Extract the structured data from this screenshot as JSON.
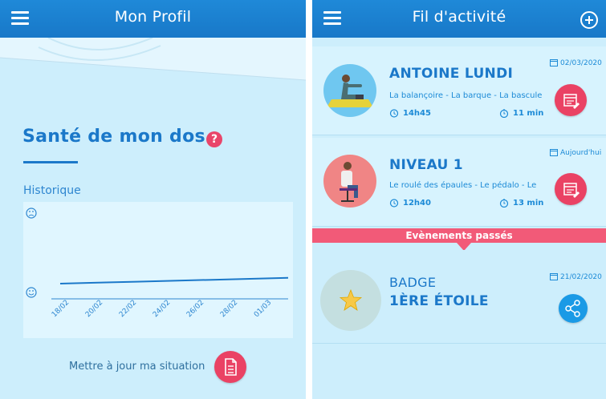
{
  "left_screen": {
    "header_title": "Mon Profil",
    "section_title": "Santé de mon dos",
    "help_symbol": "?",
    "history_label": "Historique",
    "chart_data": {
      "type": "line",
      "x_ticks": [
        "18/02",
        "20/02",
        "22/02",
        "24/02",
        "26/02",
        "28/02",
        "01/03"
      ],
      "y_axis_icons": [
        "sad-face-icon",
        "smile-face-icon"
      ],
      "series": [
        {
          "values": [
            0.78,
            0.8,
            0.82,
            0.84,
            0.86,
            0.88,
            0.9
          ]
        }
      ]
    },
    "update_label": "Mettre à jour ma situation",
    "update_icon": "document-icon"
  },
  "right_screen": {
    "header_title": "Fil d'activité",
    "activities": [
      {
        "name": "ANTOINE LUNDI",
        "description": "La balançoire - La barque - La bascule",
        "time": "14h45",
        "duration": "11 min",
        "date": "02/03/2020"
      },
      {
        "name": "NIVEAU 1",
        "description": "Le roulé des épaules - Le pédalo - Le",
        "time": "12h40",
        "duration": "13 min",
        "date": "Aujourd'hui"
      }
    ],
    "past_events_label": "Evènements passés",
    "past_event": {
      "label": "BADGE",
      "name": "1ÈRE ÉTOILE",
      "date": "21/02/2020"
    }
  },
  "colors": {
    "header_blue": "#1878c8",
    "background": "#cdeefc",
    "title_blue": "#1b78c9",
    "accent_red": "#ea4264",
    "banner_pink": "#f25a78",
    "share_blue": "#1a9ae6"
  }
}
